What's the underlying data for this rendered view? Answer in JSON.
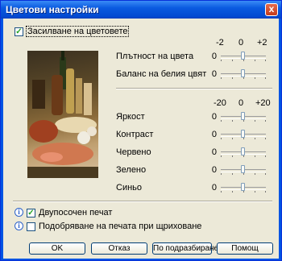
{
  "window": {
    "title": "Цветови настройки",
    "close_glyph": "x"
  },
  "enhance": {
    "label": "Засилване на цветовете",
    "checked": true
  },
  "group1": {
    "ticks": [
      "-2",
      "0",
      "+2"
    ],
    "rows": [
      {
        "label": "Плътност на цвета",
        "value": "0"
      },
      {
        "label": "Баланс на белия цвят",
        "value": "0"
      }
    ]
  },
  "group2": {
    "ticks": [
      "-20",
      "0",
      "+20"
    ],
    "rows": [
      {
        "label": "Яркост",
        "value": "0"
      },
      {
        "label": "Контраст",
        "value": "0"
      },
      {
        "label": "Червено",
        "value": "0"
      },
      {
        "label": "Зелено",
        "value": "0"
      },
      {
        "label": "Синьо",
        "value": "0"
      }
    ]
  },
  "options": {
    "duplex": {
      "label": "Двупосочен печат",
      "checked": true,
      "info_glyph": "i"
    },
    "dither": {
      "label": "Подобряване на печата при щриховане",
      "checked": false,
      "info_glyph": "i"
    }
  },
  "buttons": {
    "ok": "OK",
    "cancel": "Отказ",
    "default": "По подразбиране",
    "help": "Помощ"
  },
  "colors": {
    "title_bar": "#0054e3",
    "dialog_bg": "#ece9d8",
    "check_mark": "#21a121"
  }
}
